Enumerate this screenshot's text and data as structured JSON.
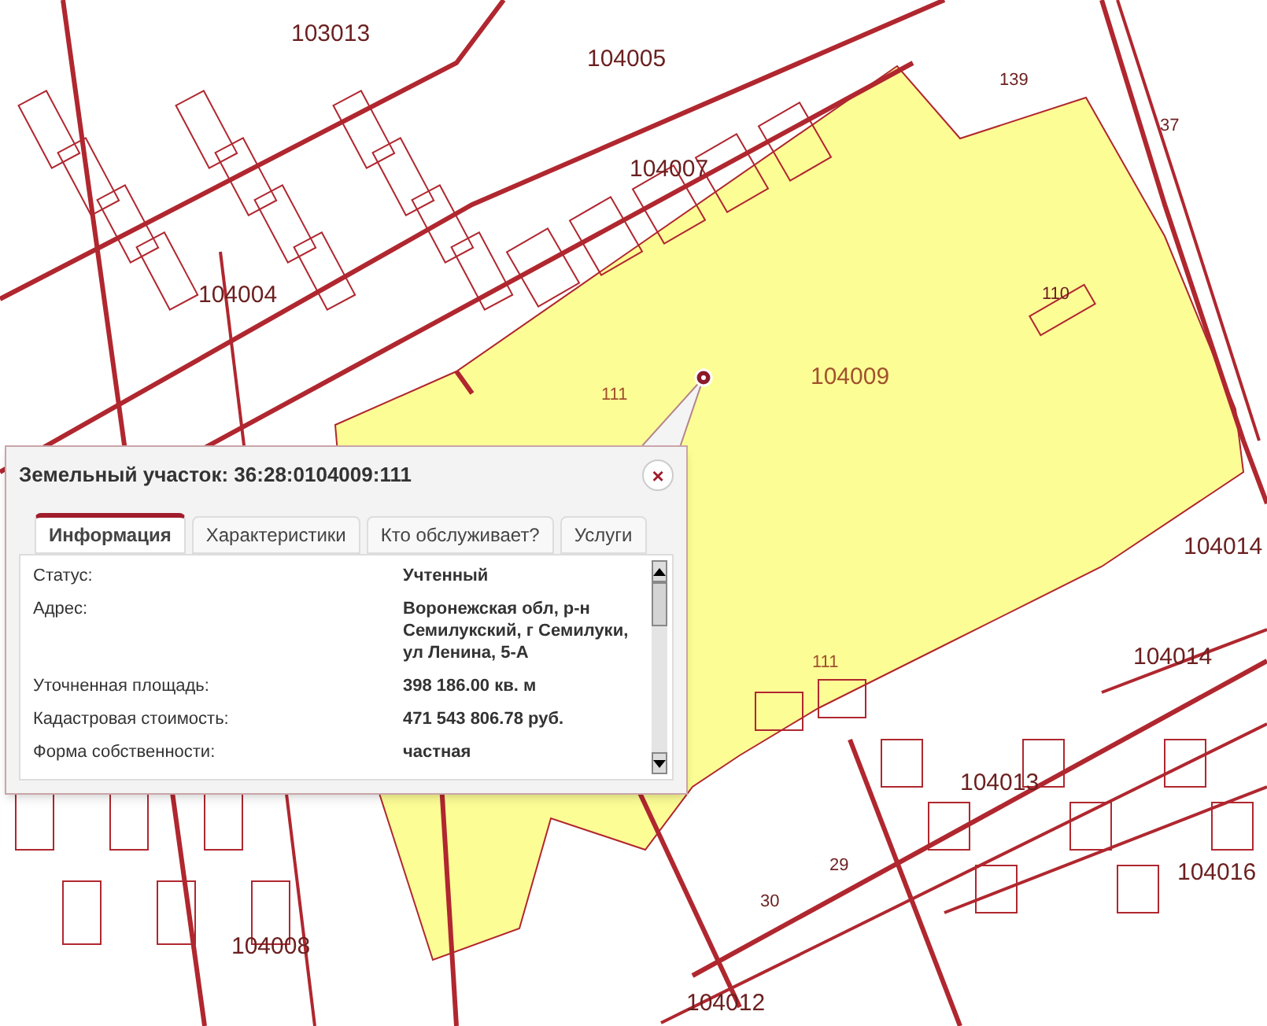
{
  "map": {
    "labels": [
      {
        "text": "103013",
        "kind": "block"
      },
      {
        "text": "104005",
        "kind": "block"
      },
      {
        "text": "104007",
        "kind": "block"
      },
      {
        "text": "104004",
        "kind": "block"
      },
      {
        "text": "104009",
        "kind": "selected-block"
      },
      {
        "text": "111",
        "kind": "selected-lot"
      },
      {
        "text": "110",
        "kind": "lot"
      },
      {
        "text": "37",
        "kind": "lot"
      },
      {
        "text": "139",
        "kind": "lot"
      },
      {
        "text": "104014",
        "kind": "block"
      },
      {
        "text": "104014",
        "kind": "block"
      },
      {
        "text": "111",
        "kind": "selected-lot"
      },
      {
        "text": "104013",
        "kind": "block"
      },
      {
        "text": "104016",
        "kind": "block"
      },
      {
        "text": "104008",
        "kind": "block"
      },
      {
        "text": "104012",
        "kind": "block"
      },
      {
        "text": "29",
        "kind": "lot"
      },
      {
        "text": "30",
        "kind": "lot"
      }
    ]
  },
  "popup": {
    "title": "Земельный участок: 36:28:0104009:111",
    "close": "×",
    "tabs": [
      {
        "label": "Информация",
        "selected": true
      },
      {
        "label": "Характеристики",
        "selected": false
      },
      {
        "label": "Кто обслуживает?",
        "selected": false
      },
      {
        "label": "Услуги",
        "selected": false
      }
    ],
    "rows": [
      {
        "label": "Статус:",
        "value": "Учтенный"
      },
      {
        "label": "Адрес:",
        "value": "Воронежская обл, р-н Семилукский, г Семилуки, ул Ленина, 5-А"
      },
      {
        "label": "Уточненная площадь:",
        "value": "398 186.00 кв. м"
      },
      {
        "label": "Кадастровая стоимость:",
        "value": "471 543 806.78 руб."
      },
      {
        "label": "Форма собственности:",
        "value": "частная"
      }
    ]
  }
}
